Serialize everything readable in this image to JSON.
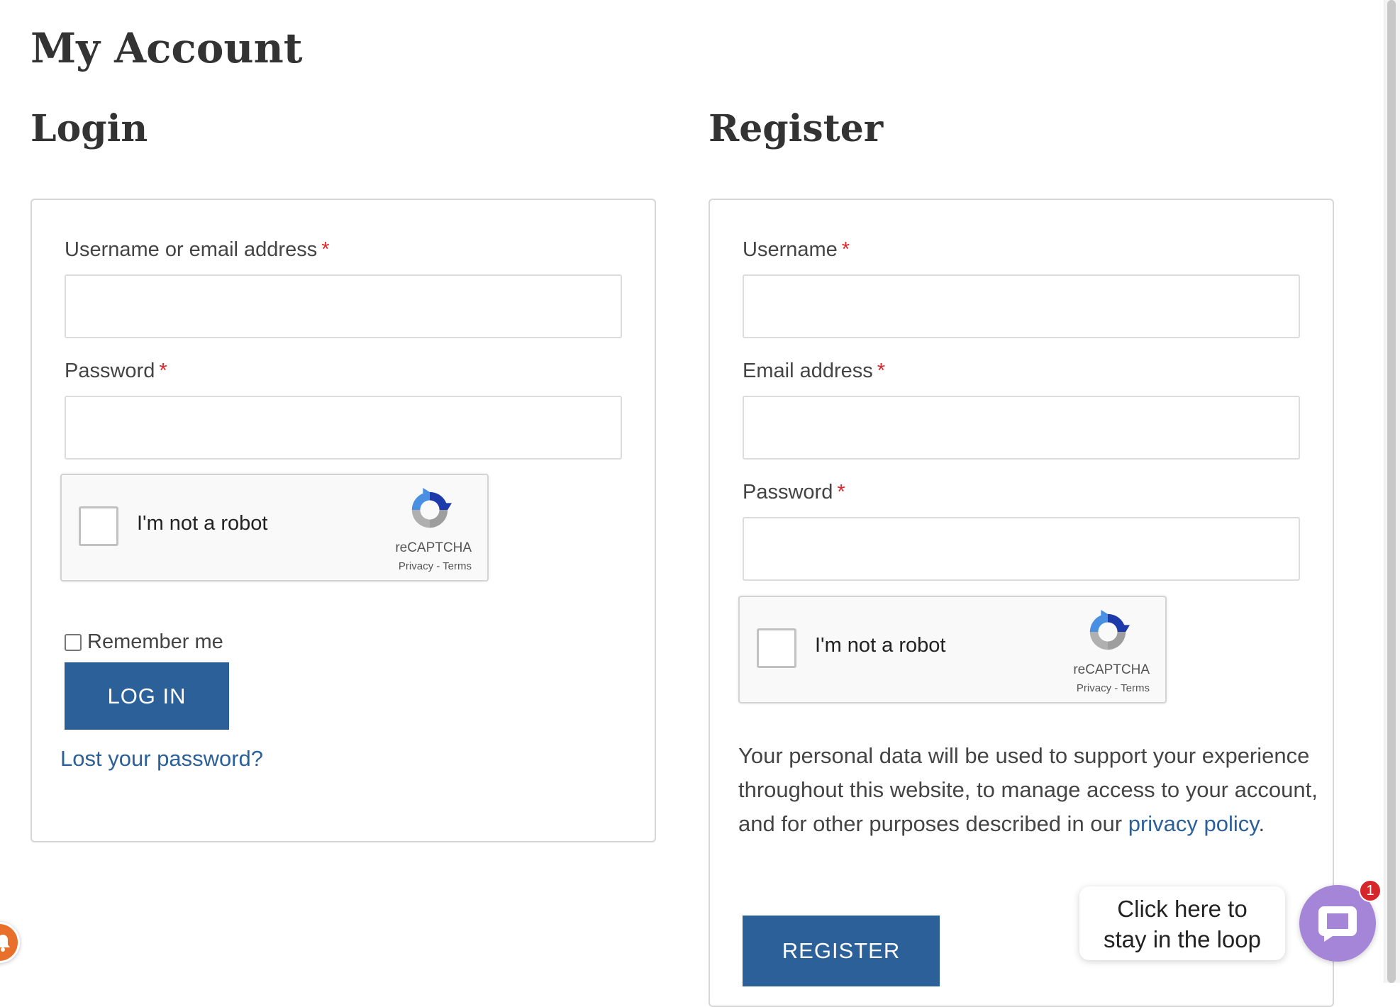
{
  "page": {
    "title": "My Account"
  },
  "login": {
    "heading": "Login",
    "username_label": "Username or email address",
    "password_label": "Password",
    "required_mark": "*",
    "username_value": "",
    "password_value": "",
    "recaptcha": {
      "label": "I'm not a robot",
      "brand": "reCAPTCHA",
      "privacy": "Privacy",
      "separator": " - ",
      "terms": "Terms"
    },
    "remember_label": "Remember me",
    "remember_checked": false,
    "submit_label": "LOG IN",
    "lost_password": "Lost your password?"
  },
  "register": {
    "heading": "Register",
    "username_label": "Username",
    "email_label": "Email address",
    "password_label": "Password",
    "required_mark": "*",
    "username_value": "",
    "email_value": "",
    "password_value": "",
    "recaptcha": {
      "label": "I'm not a robot",
      "brand": "reCAPTCHA",
      "privacy": "Privacy",
      "separator": " - ",
      "terms": "Terms"
    },
    "privacy_text": "Your personal data will be used to support your experience throughout this website, to manage access to your account, and for other purposes described in our ",
    "privacy_link": "privacy policy",
    "privacy_suffix": ".",
    "submit_label": "REGISTER"
  },
  "chat": {
    "prompt_line1": "Click here to",
    "prompt_line2": "stay in the loop",
    "badge_count": "1"
  },
  "colors": {
    "accent": "#2b6099",
    "required": "#e0262b",
    "chat_launcher": "#a585d8",
    "chat_badge": "#d7262b",
    "side_widget": "#e8702a"
  },
  "icons": {
    "recaptcha": "recaptcha-logo-icon",
    "chat": "chat-bubble-icon",
    "side_widget": "bell-icon"
  }
}
